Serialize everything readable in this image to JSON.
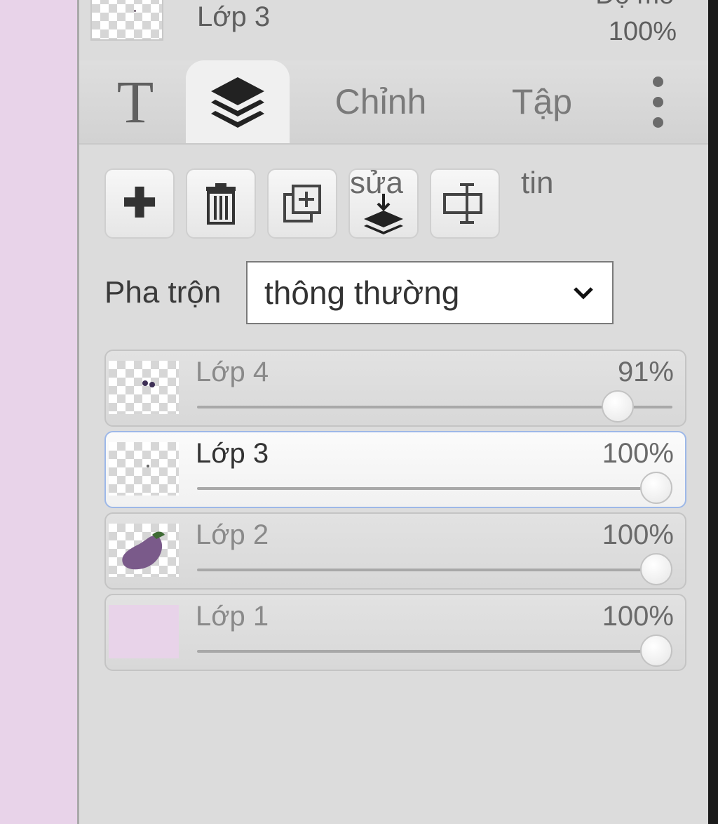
{
  "top_layer": {
    "name": "Lớp 3",
    "opacity_label": "Độ mờ",
    "opacity_value": "100%"
  },
  "tabs": [
    {
      "label": "T",
      "icon": "text-icon"
    },
    {
      "label": "",
      "icon": "layers-icon"
    },
    {
      "label": "Chỉnh"
    },
    {
      "label": "Tập"
    },
    {
      "label": "",
      "icon": "more-vert-icon"
    }
  ],
  "toolbar": {
    "buttons": [
      {
        "icon": "plus-icon"
      },
      {
        "icon": "trash-icon"
      },
      {
        "icon": "duplicate-icon"
      },
      {
        "icon": "merge-down-icon"
      },
      {
        "icon": "rename-icon"
      }
    ],
    "merge_caption": "sửa",
    "extra_caption": "tin"
  },
  "blend": {
    "label": "Pha trộn",
    "value": "thông thường"
  },
  "layers": [
    {
      "name": "Lớp 4",
      "opacity_label": "91%",
      "opacity": 0.91
    },
    {
      "name": "Lớp 3",
      "opacity_label": "100%",
      "opacity": 1.0,
      "active": true
    },
    {
      "name": "Lớp 2",
      "opacity_label": "100%",
      "opacity": 1.0
    },
    {
      "name": "Lớp 1",
      "opacity_label": "100%",
      "opacity": 1.0
    }
  ],
  "colors": {
    "canvas_bg": "#e8d3e9",
    "panel_bg": "#dcdcdc",
    "active_border": "#9db8e8",
    "eggplant": "#7a5a8a"
  }
}
